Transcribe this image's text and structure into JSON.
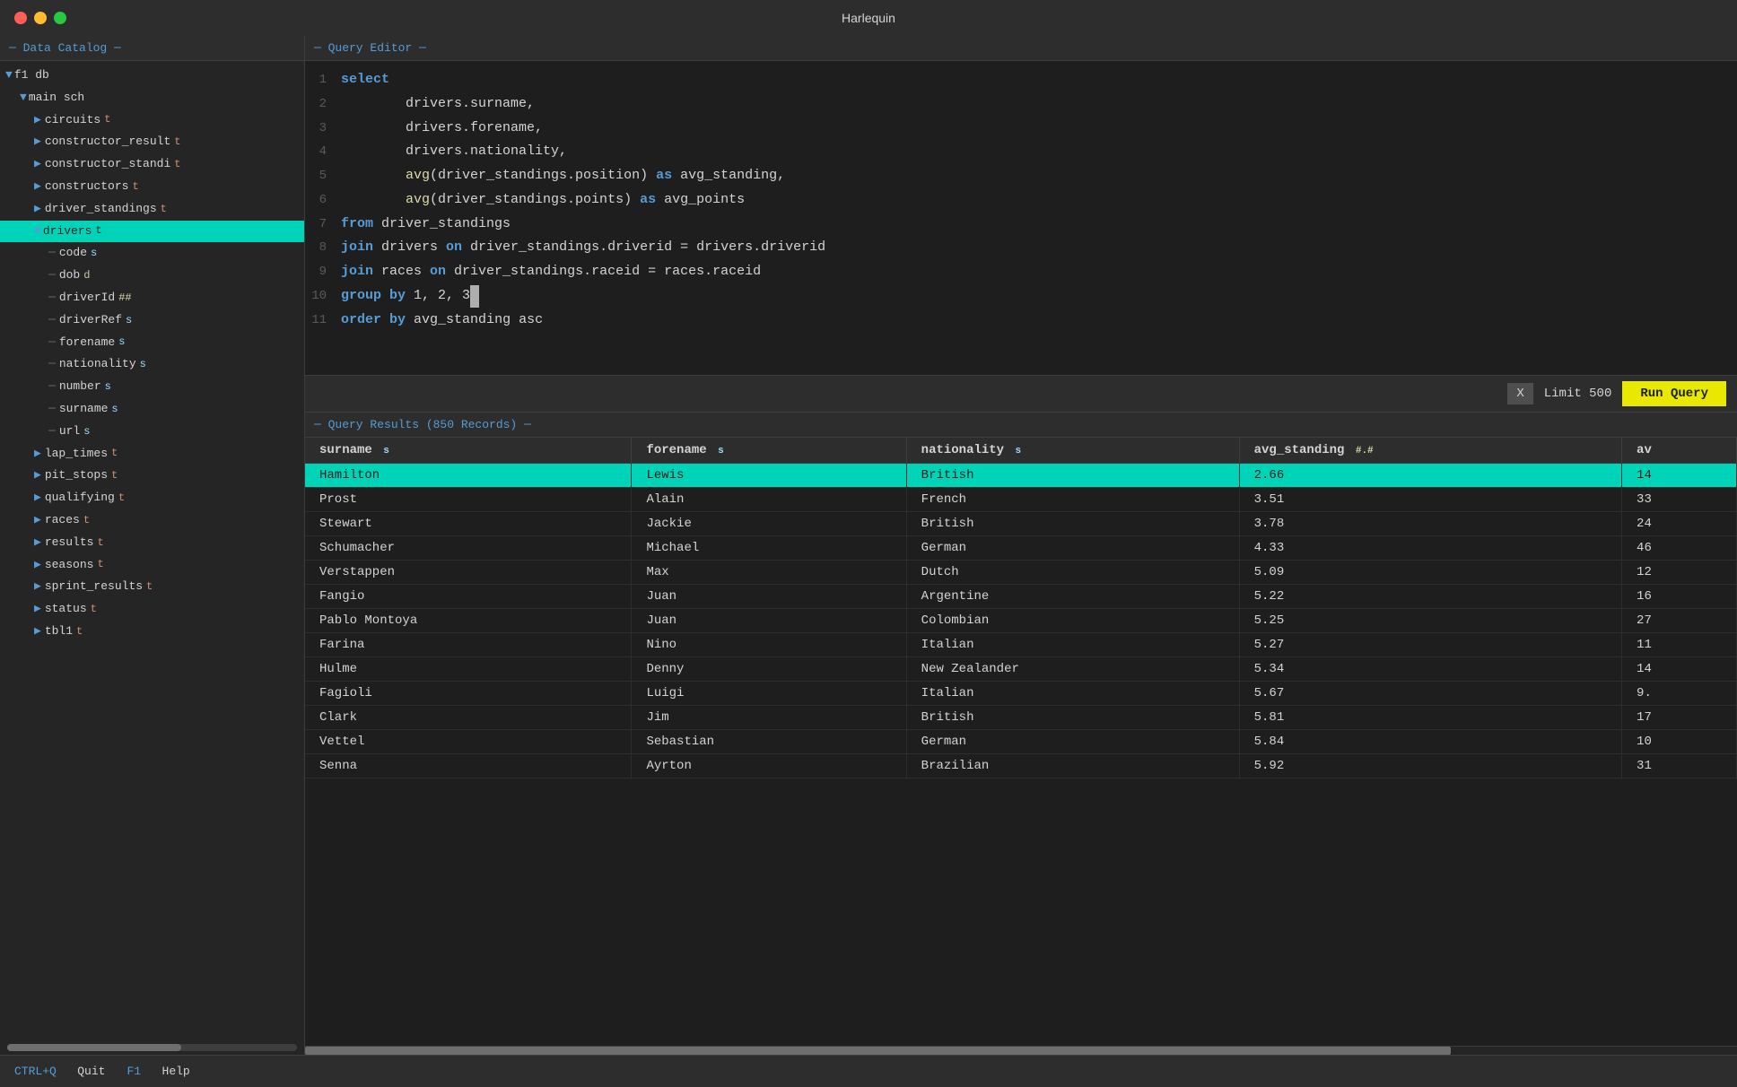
{
  "app": {
    "title": "Harlequin"
  },
  "sidebar": {
    "header": "─ Data Catalog ─",
    "db": {
      "name": "f1 db",
      "schema": {
        "name": "main sch",
        "tables": [
          {
            "name": "circuits",
            "type": "t",
            "expanded": false
          },
          {
            "name": "constructor_result",
            "type": "t",
            "expanded": false
          },
          {
            "name": "constructor_standi",
            "type": "t",
            "expanded": false
          },
          {
            "name": "constructors",
            "type": "t",
            "expanded": false
          },
          {
            "name": "driver_standings",
            "type": "t",
            "expanded": false
          },
          {
            "name": "drivers",
            "type": "t",
            "expanded": true,
            "highlighted": true,
            "columns": [
              {
                "name": "code",
                "type": "s"
              },
              {
                "name": "dob",
                "type": "d"
              },
              {
                "name": "driverId",
                "type": "##"
              },
              {
                "name": "driverRef",
                "type": "s"
              },
              {
                "name": "forename",
                "type": "s"
              },
              {
                "name": "nationality",
                "type": "s"
              },
              {
                "name": "number",
                "type": "s"
              },
              {
                "name": "surname",
                "type": "s"
              },
              {
                "name": "url",
                "type": "s"
              }
            ]
          },
          {
            "name": "lap_times",
            "type": "t",
            "expanded": false
          },
          {
            "name": "pit_stops",
            "type": "t",
            "expanded": false
          },
          {
            "name": "qualifying",
            "type": "t",
            "expanded": false
          },
          {
            "name": "races",
            "type": "t",
            "expanded": false
          },
          {
            "name": "results",
            "type": "t",
            "expanded": false
          },
          {
            "name": "seasons",
            "type": "t",
            "expanded": false
          },
          {
            "name": "sprint_results",
            "type": "t",
            "expanded": false
          },
          {
            "name": "status",
            "type": "t",
            "expanded": false
          },
          {
            "name": "tbl1",
            "type": "t",
            "expanded": false
          }
        ]
      }
    }
  },
  "query_editor": {
    "header": "─ Query Editor ─",
    "lines": [
      {
        "num": 1,
        "content": "select"
      },
      {
        "num": 2,
        "content": "    drivers.surname,"
      },
      {
        "num": 3,
        "content": "    drivers.forename,"
      },
      {
        "num": 4,
        "content": "    drivers.nationality,"
      },
      {
        "num": 5,
        "content": "    avg(driver_standings.position) as avg_standing,"
      },
      {
        "num": 6,
        "content": "    avg(driver_standings.points) as avg_points"
      },
      {
        "num": 7,
        "content": "from driver_standings"
      },
      {
        "num": 8,
        "content": "join drivers on driver_standings.driverid = drivers.driverid"
      },
      {
        "num": 9,
        "content": "join races on driver_standings.raceid = races.raceid"
      },
      {
        "num": 10,
        "content": "group by 1, 2, 3"
      },
      {
        "num": 11,
        "content": "order by avg_standing asc"
      }
    ]
  },
  "toolbar": {
    "x_label": "X",
    "limit_label": "Limit 500",
    "run_label": "Run Query"
  },
  "results": {
    "header": "─ Query Results (850 Records) ─",
    "columns": [
      {
        "name": "surname",
        "type": "s"
      },
      {
        "name": "forename",
        "type": "s"
      },
      {
        "name": "nationality",
        "type": "s"
      },
      {
        "name": "avg_standing",
        "type": "#.#"
      },
      {
        "name": "av",
        "type": ""
      }
    ],
    "rows": [
      {
        "surname": "Hamilton",
        "forename": "Lewis",
        "nationality": "British",
        "avg_standing": "2.66",
        "av": "14",
        "selected": true
      },
      {
        "surname": "Prost",
        "forename": "Alain",
        "nationality": "French",
        "avg_standing": "3.51",
        "av": "33"
      },
      {
        "surname": "Stewart",
        "forename": "Jackie",
        "nationality": "British",
        "avg_standing": "3.78",
        "av": "24"
      },
      {
        "surname": "Schumacher",
        "forename": "Michael",
        "nationality": "German",
        "avg_standing": "4.33",
        "av": "46"
      },
      {
        "surname": "Verstappen",
        "forename": "Max",
        "nationality": "Dutch",
        "avg_standing": "5.09",
        "av": "12"
      },
      {
        "surname": "Fangio",
        "forename": "Juan",
        "nationality": "Argentine",
        "avg_standing": "5.22",
        "av": "16"
      },
      {
        "surname": "Pablo Montoya",
        "forename": "Juan",
        "nationality": "Colombian",
        "avg_standing": "5.25",
        "av": "27"
      },
      {
        "surname": "Farina",
        "forename": "Nino",
        "nationality": "Italian",
        "avg_standing": "5.27",
        "av": "11"
      },
      {
        "surname": "Hulme",
        "forename": "Denny",
        "nationality": "New Zealander",
        "avg_standing": "5.34",
        "av": "14"
      },
      {
        "surname": "Fagioli",
        "forename": "Luigi",
        "nationality": "Italian",
        "avg_standing": "5.67",
        "av": "9."
      },
      {
        "surname": "Clark",
        "forename": "Jim",
        "nationality": "British",
        "avg_standing": "5.81",
        "av": "17"
      },
      {
        "surname": "Vettel",
        "forename": "Sebastian",
        "nationality": "German",
        "avg_standing": "5.84",
        "av": "10"
      },
      {
        "surname": "Senna",
        "forename": "Ayrton",
        "nationality": "Brazilian",
        "avg_standing": "5.92",
        "av": "31"
      }
    ]
  },
  "status_bar": {
    "quit_shortcut": "CTRL+Q",
    "quit_label": "Quit",
    "f1_shortcut": "F1",
    "help_label": "Help"
  }
}
